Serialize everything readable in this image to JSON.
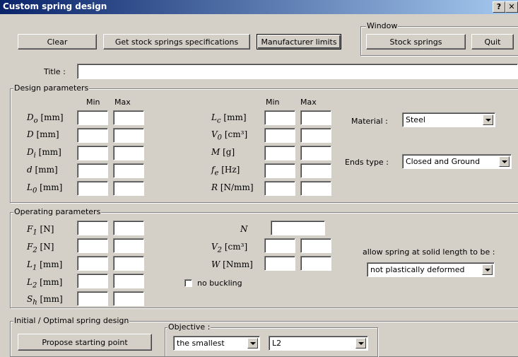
{
  "window": {
    "title": "Custom spring design",
    "help_label": "?",
    "close_label": "✕"
  },
  "toolbar": {
    "clear": "Clear",
    "stock_specs": "Get stock springs specifications",
    "manufacturer_limits": "Manufacturer limits"
  },
  "window_group": {
    "label": "Window",
    "stock_springs": "Stock springs",
    "quit": "Quit"
  },
  "title_field": {
    "label": "Title :",
    "value": ""
  },
  "design": {
    "label": "Design parameters",
    "min": "Min",
    "max": "Max",
    "left": [
      {
        "sym": "D",
        "sub": "o",
        "unit": "[mm]"
      },
      {
        "sym": "D",
        "sub": "",
        "unit": "[mm]"
      },
      {
        "sym": "D",
        "sub": "i",
        "unit": "[mm]"
      },
      {
        "sym": "d",
        "sub": "",
        "unit": "[mm]"
      },
      {
        "sym": "L",
        "sub": "0",
        "unit": "[mm]"
      }
    ],
    "right": [
      {
        "sym": "L",
        "sub": "c",
        "unit": "[mm]"
      },
      {
        "sym": "V",
        "sub": "0",
        "unit": "[cm³]"
      },
      {
        "sym": "M",
        "sub": "",
        "unit": "[g]"
      },
      {
        "sym": "f",
        "sub": "e",
        "unit": "[Hz]"
      },
      {
        "sym": "R",
        "sub": "",
        "unit": "[N/mm]"
      }
    ],
    "material_label": "Material :",
    "material_value": "Steel",
    "ends_label": "Ends type :",
    "ends_value": "Closed and Ground"
  },
  "operating": {
    "label": "Operating parameters",
    "left": [
      {
        "sym": "F",
        "sub": "1",
        "unit": "[N]"
      },
      {
        "sym": "F",
        "sub": "2",
        "unit": "[N]"
      },
      {
        "sym": "L",
        "sub": "1",
        "unit": "[mm]"
      },
      {
        "sym": "L",
        "sub": "2",
        "unit": "[mm]"
      },
      {
        "sym": "S",
        "sub": "h",
        "unit": "[mm]"
      }
    ],
    "right": [
      {
        "sym": "N",
        "sub": "",
        "unit": ""
      },
      {
        "sym": "V",
        "sub": "2",
        "unit": "[cm³]"
      },
      {
        "sym": "W",
        "sub": "",
        "unit": "[Nmm]"
      }
    ],
    "no_buckling": "no buckling",
    "solid_label": "allow spring at solid length to be :",
    "solid_value": "not plastically deformed"
  },
  "initial": {
    "label": "Initial / Optimal spring design",
    "propose": "Propose starting point",
    "objective_label": "Objective :",
    "objective_mode": "the smallest",
    "objective_target": "L2"
  }
}
